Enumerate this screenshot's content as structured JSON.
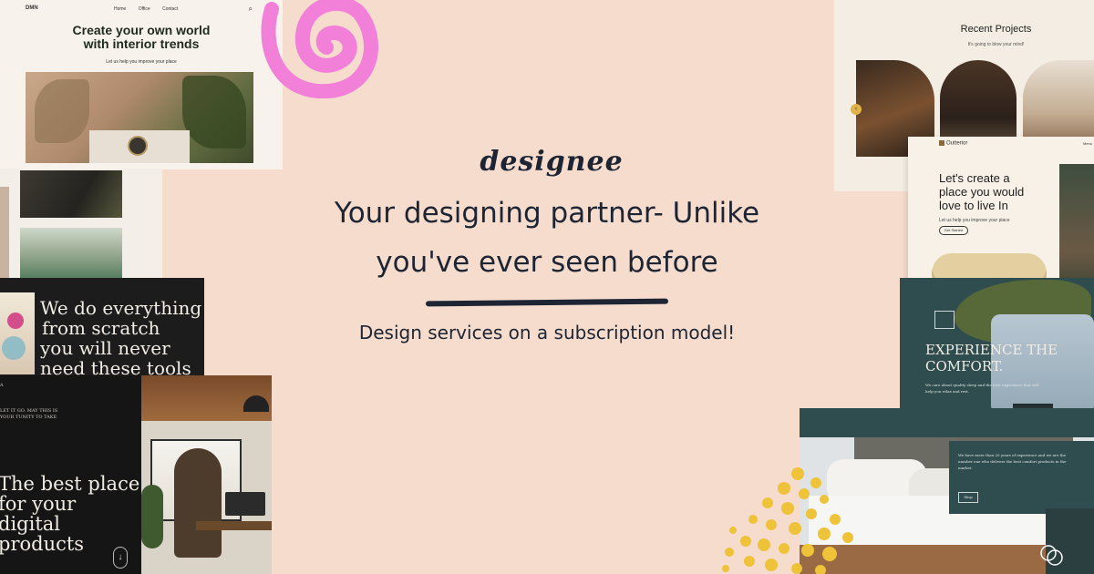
{
  "hero": {
    "brand": "designee",
    "headline_line1": "Your designing partner- Unlike",
    "headline_line2": "you've ever seen before",
    "subline": "Design services on a subscription model!"
  },
  "card_interior": {
    "logo": "DMN",
    "nav": [
      "Home",
      "Office",
      "Contact"
    ],
    "title_line1": "Create your own world",
    "title_line2": "with interior trends",
    "subtitle": "Let us help you improve your place"
  },
  "card_scratch": {
    "lines": [
      "We do everything",
      "from scratch",
      "you will never",
      "need these tools"
    ]
  },
  "card_best_place": {
    "small_a": "A",
    "small_text": "LET IT GO. MAY THIS IS YOUR TUNITY TO TAKE",
    "lines": [
      "The best place",
      "for your",
      "digital",
      "products"
    ],
    "arrow": "↓"
  },
  "card_recent": {
    "title": "Recent Projects",
    "subtitle": "It's going to blow your mind!",
    "nav_dot": "‹"
  },
  "card_outterior": {
    "logo": "Outterior",
    "menu": "Menu",
    "title_line1": "Let's create a",
    "title_line2": "place you would",
    "title_line3": "love to live In",
    "subtitle": "Let us help you improve your place",
    "button": "Get Started"
  },
  "card_comfort": {
    "title_line1": "EXPERIENCE THE",
    "title_line2": "COMFORT.",
    "text": "We care about quality sleep and the best experience that will help you relax and rest.",
    "button": "Shop"
  },
  "card_bed": {
    "text": "We have more than 20 years of experience and we are the number one who delivers the best comfort products in the market.",
    "button": "Shop"
  },
  "colors": {
    "background": "#f6dccd",
    "text_dark": "#1d2433",
    "spiral": "#f27fd8",
    "dots": "#eec33a",
    "teal": "#2f4c4e"
  }
}
